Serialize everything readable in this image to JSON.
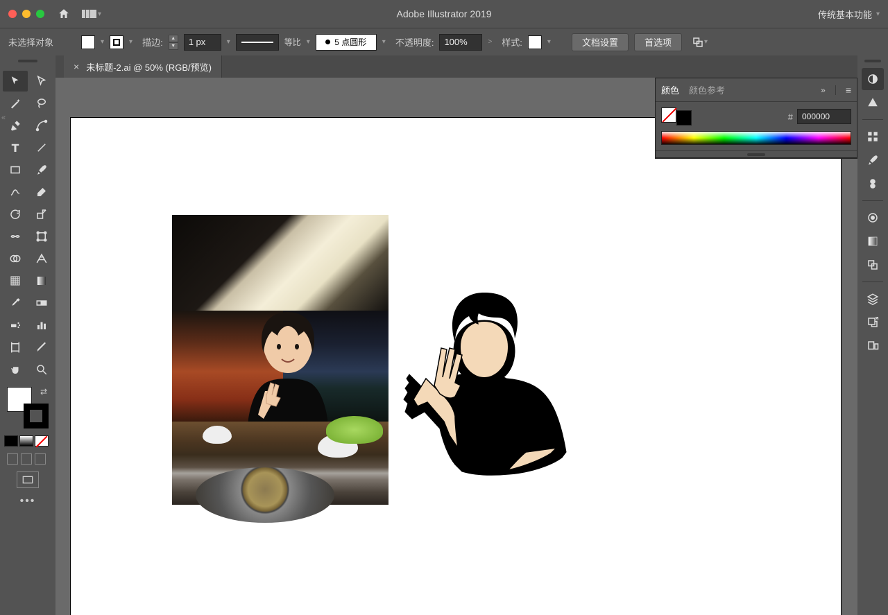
{
  "titlebar": {
    "app_title": "Adobe Illustrator 2019",
    "workspace_label": "传统基本功能"
  },
  "controlbar": {
    "selection_label": "未选择对象",
    "stroke_label": "描边:",
    "stroke_width": "1 px",
    "profile_label": "等比",
    "brush_label": "5 点圆形",
    "opacity_label": "不透明度:",
    "opacity_value": "100%",
    "style_label": "样式:",
    "doc_setup": "文档设置",
    "preferences": "首选项"
  },
  "tab": {
    "name": "未标题-2.ai @ 50% (RGB/预览)"
  },
  "color_panel": {
    "tab_color": "颜色",
    "tab_guide": "颜色参考",
    "hash": "#",
    "hex": "000000"
  },
  "tools": {
    "dots": "•••"
  }
}
